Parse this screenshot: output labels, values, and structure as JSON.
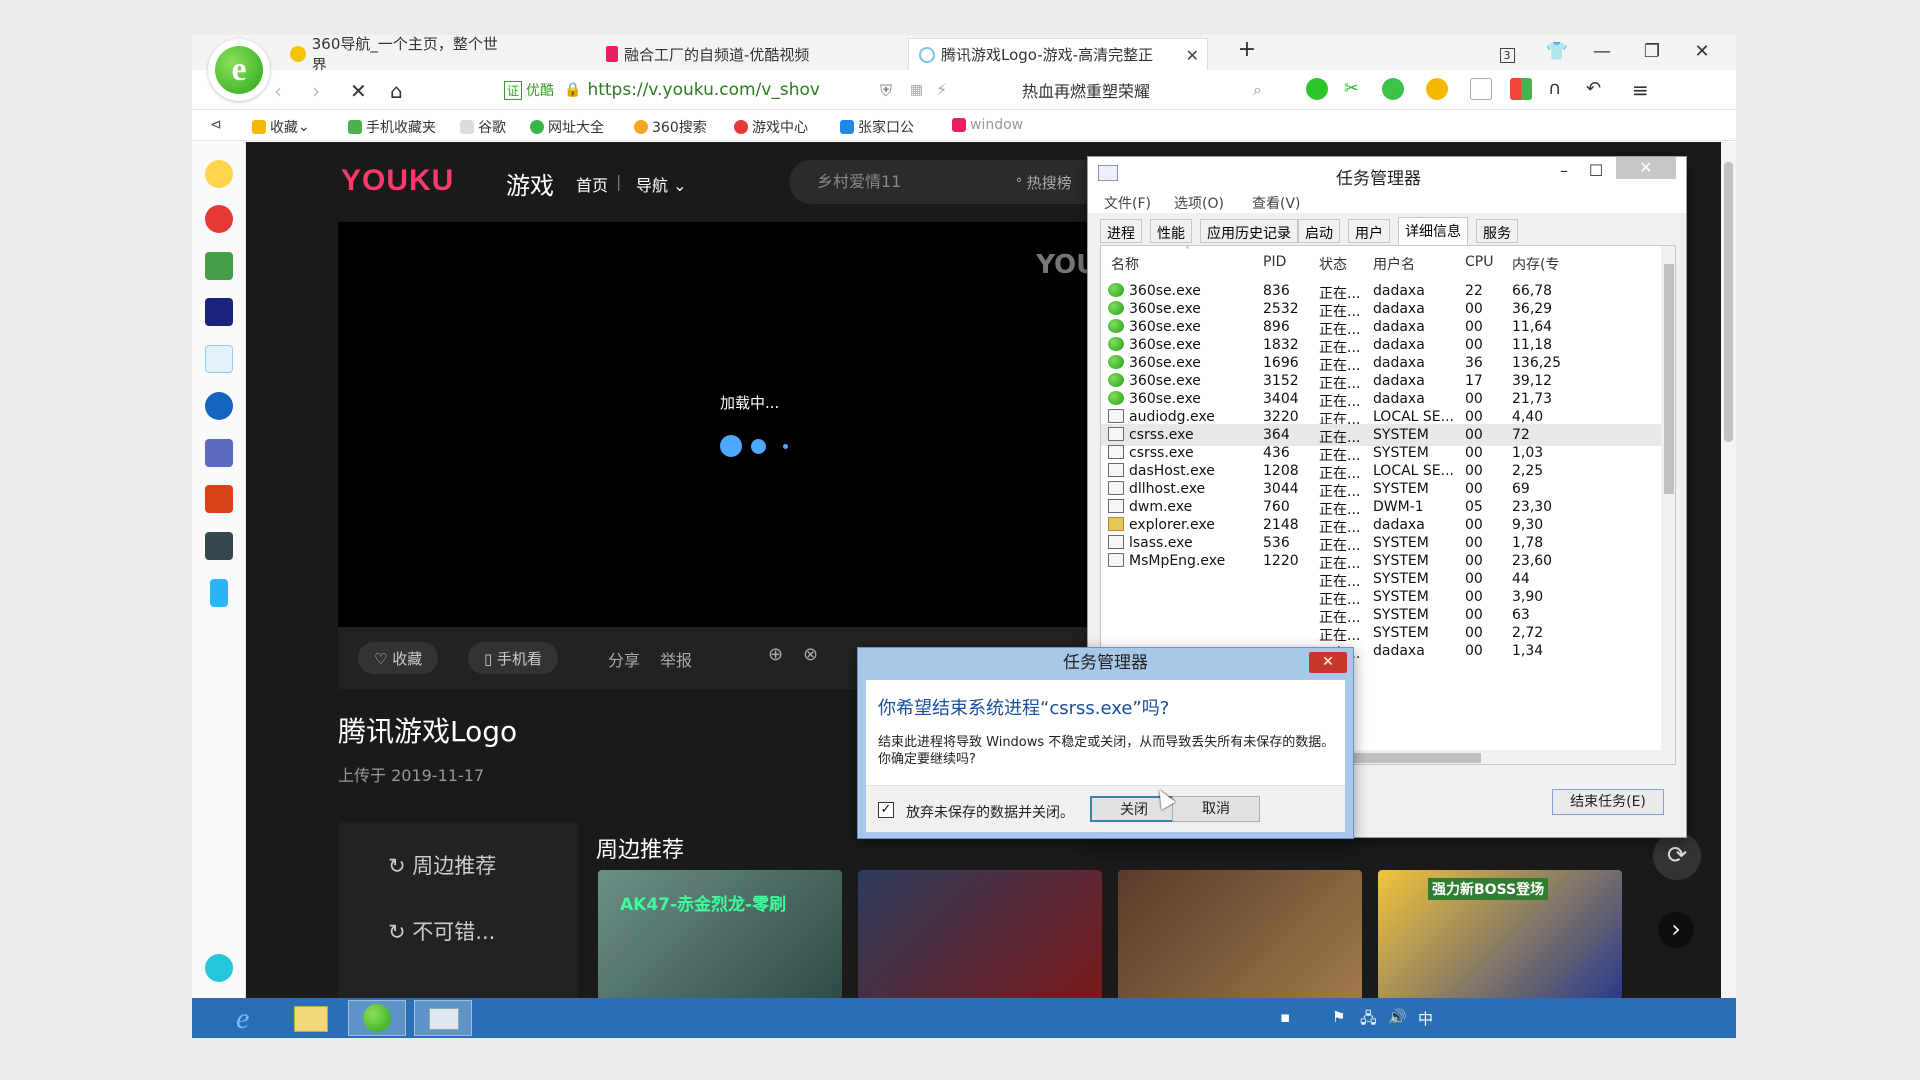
{
  "browser": {
    "tabs": [
      {
        "label": "360导航_一个主页，整个世界"
      },
      {
        "label": "融合工厂的自频道-优酷视频"
      },
      {
        "label": "腾讯游戏Logo-游戏-高清完整正"
      }
    ],
    "tab_count_badge": "3",
    "address": {
      "cert_label": "证",
      "cert_name": "优酷",
      "url": "https://v.youku.com/v_shov"
    },
    "search_text": "热血再燃重塑荣耀",
    "bookmarks": [
      {
        "label": "收藏",
        "color": "#f5b800"
      },
      {
        "label": "手机收藏夹",
        "color": "#4caf50"
      },
      {
        "label": "谷歌",
        "color": "#999999"
      },
      {
        "label": "网址大全",
        "color": "#3ab54a"
      },
      {
        "label": "360搜索",
        "color": "#f5a623"
      },
      {
        "label": "游戏中心",
        "color": "#e53935"
      },
      {
        "label": "张家口公",
        "color": "#1e88e5"
      },
      {
        "label": "window",
        "color": "#e91e63"
      }
    ]
  },
  "youku": {
    "logo": "YOUKU",
    "channel": "游戏",
    "nav_home": "首页",
    "nav_menu": "导航",
    "search_placeholder": "乡村爱情11",
    "hot": "热搜榜",
    "watermark": "YOUKU",
    "loading_text": "加载中...",
    "actions": {
      "favorite": "收藏",
      "mobile": "手机看",
      "share": "分享",
      "report": "举报"
    },
    "video_title": "腾讯游戏Logo",
    "upload_date": "上传于 2019-11-17",
    "side_items": [
      "周边推荐",
      "不可错..."
    ],
    "rec_title": "周边推荐",
    "thumb1_text": "AK47-赤金烈龙-零刷",
    "thumb4_text": "强力新BOSS登场"
  },
  "task_manager": {
    "title": "任务管理器",
    "menu": [
      "文件(F)",
      "选项(O)",
      "查看(V)"
    ],
    "tabs": [
      "进程",
      "性能",
      "应用历史记录",
      "启动",
      "用户",
      "详细信息",
      "服务"
    ],
    "active_tab": "详细信息",
    "columns": [
      "名称",
      "PID",
      "状态",
      "用户名",
      "CPU",
      "内存(专"
    ],
    "rows": [
      {
        "name": "360se.exe",
        "pid": "836",
        "status": "正在...",
        "user": "dadaxa",
        "cpu": "22",
        "mem": "66,78",
        "icon": "g"
      },
      {
        "name": "360se.exe",
        "pid": "2532",
        "status": "正在...",
        "user": "dadaxa",
        "cpu": "00",
        "mem": "36,29",
        "icon": "g"
      },
      {
        "name": "360se.exe",
        "pid": "896",
        "status": "正在...",
        "user": "dadaxa",
        "cpu": "00",
        "mem": "11,64",
        "icon": "g"
      },
      {
        "name": "360se.exe",
        "pid": "1832",
        "status": "正在...",
        "user": "dadaxa",
        "cpu": "00",
        "mem": "11,18",
        "icon": "g"
      },
      {
        "name": "360se.exe",
        "pid": "1696",
        "status": "正在...",
        "user": "dadaxa",
        "cpu": "36",
        "mem": "136,25",
        "icon": "g"
      },
      {
        "name": "360se.exe",
        "pid": "3152",
        "status": "正在...",
        "user": "dadaxa",
        "cpu": "17",
        "mem": "39,12",
        "icon": "g"
      },
      {
        "name": "360se.exe",
        "pid": "3404",
        "status": "正在...",
        "user": "dadaxa",
        "cpu": "00",
        "mem": "21,73",
        "icon": "g"
      },
      {
        "name": "audiodg.exe",
        "pid": "3220",
        "status": "正在...",
        "user": "LOCAL SE...",
        "cpu": "00",
        "mem": "4,40",
        "icon": "w"
      },
      {
        "name": "csrss.exe",
        "pid": "364",
        "status": "正在...",
        "user": "SYSTEM",
        "cpu": "00",
        "mem": "72",
        "icon": "w"
      },
      {
        "name": "csrss.exe",
        "pid": "436",
        "status": "正在...",
        "user": "SYSTEM",
        "cpu": "00",
        "mem": "1,03",
        "icon": "w"
      },
      {
        "name": "dasHost.exe",
        "pid": "1208",
        "status": "正在...",
        "user": "LOCAL SE...",
        "cpu": "00",
        "mem": "2,25",
        "icon": "w"
      },
      {
        "name": "dllhost.exe",
        "pid": "3044",
        "status": "正在...",
        "user": "SYSTEM",
        "cpu": "00",
        "mem": "69",
        "icon": "w"
      },
      {
        "name": "dwm.exe",
        "pid": "760",
        "status": "正在...",
        "user": "DWM-1",
        "cpu": "05",
        "mem": "23,30",
        "icon": "w"
      },
      {
        "name": "explorer.exe",
        "pid": "2148",
        "status": "正在...",
        "user": "dadaxa",
        "cpu": "00",
        "mem": "9,30",
        "icon": "f"
      },
      {
        "name": "lsass.exe",
        "pid": "536",
        "status": "正在...",
        "user": "SYSTEM",
        "cpu": "00",
        "mem": "1,78",
        "icon": "w"
      },
      {
        "name": "MsMpEng.exe",
        "pid": "1220",
        "status": "正在...",
        "user": "SYSTEM",
        "cpu": "00",
        "mem": "23,60",
        "icon": "w"
      },
      {
        "name": "",
        "pid": "",
        "status": "正在...",
        "user": "SYSTEM",
        "cpu": "00",
        "mem": "44",
        "icon": ""
      },
      {
        "name": "",
        "pid": "",
        "status": "正在...",
        "user": "SYSTEM",
        "cpu": "00",
        "mem": "3,90",
        "icon": ""
      },
      {
        "name": "",
        "pid": "",
        "status": "正在...",
        "user": "SYSTEM",
        "cpu": "00",
        "mem": "63",
        "icon": ""
      },
      {
        "name": "",
        "pid": "",
        "status": "正在...",
        "user": "SYSTEM",
        "cpu": "00",
        "mem": "2,72",
        "icon": ""
      },
      {
        "name": "",
        "pid": "",
        "status": "正在...",
        "user": "dadaxa",
        "cpu": "00",
        "mem": "1,34",
        "icon": ""
      }
    ],
    "selected_row": 8,
    "end_task": "结束任务(E)"
  },
  "dialog": {
    "title": "任务管理器",
    "question": "你希望结束系统进程“csrss.exe”吗?",
    "message": "结束此进程将导致 Windows 不稳定或关闭，从而导致丢失所有未保存的数据。你确定要继续吗?",
    "checkbox_label": "放弃未保存的数据并关闭。",
    "checkbox_checked": true,
    "ok": "关闭",
    "cancel": "取消"
  },
  "taskbar": {
    "tray_ime": "中"
  }
}
